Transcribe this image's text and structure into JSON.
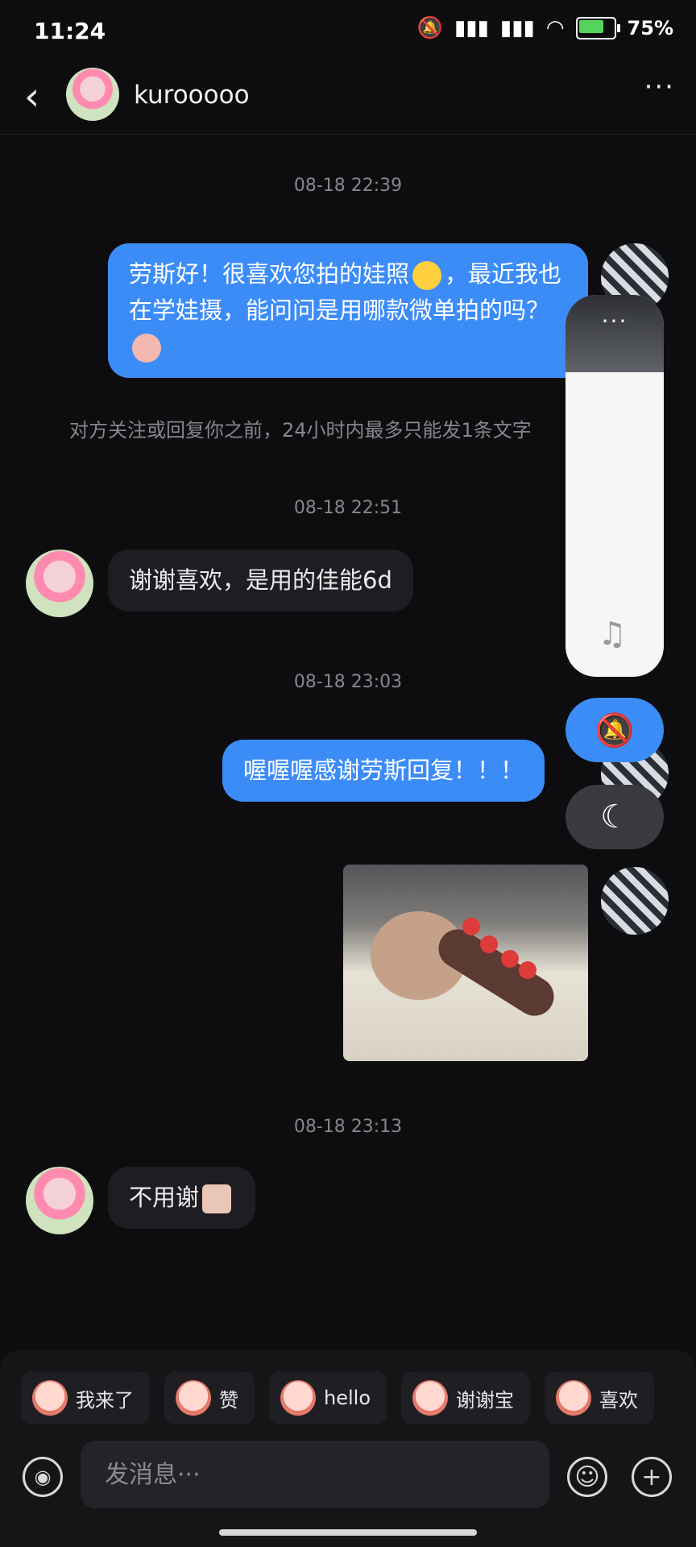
{
  "status": {
    "time": "11:24",
    "battery": "75%"
  },
  "header": {
    "back": "‹",
    "username": "kurooooo",
    "more": "···"
  },
  "messages": {
    "ts1": "08-18 22:39",
    "msg1_part1": "劳斯好！很喜欢您拍的娃照",
    "msg1_part2": "，最近我也在学娃摄，能问问是用哪款微单拍的吗？",
    "notice": "对方关注或回复你之前，24小时内最多只能发1条文字",
    "ts2": "08-18 22:51",
    "msg2": "谢谢喜欢，是用的佳能6d",
    "ts3": "08-18 23:03",
    "msg3": "喔喔喔感谢劳斯回复！！！",
    "ts4": "08-18 23:13",
    "msg4": "不用谢"
  },
  "float_panel": {
    "dots": "···",
    "note_icon": "♫",
    "bell_icon": "🔕",
    "moon_icon": "☾"
  },
  "quick_replies": [
    {
      "label": "我来了"
    },
    {
      "label": "赞"
    },
    {
      "label": "hello"
    },
    {
      "label": "谢谢宝"
    },
    {
      "label": "喜欢"
    }
  ],
  "input": {
    "placeholder": "发消息···"
  },
  "icons": {
    "voice": "voice-icon",
    "emoji": "smile-icon",
    "plus": "plus-icon"
  }
}
